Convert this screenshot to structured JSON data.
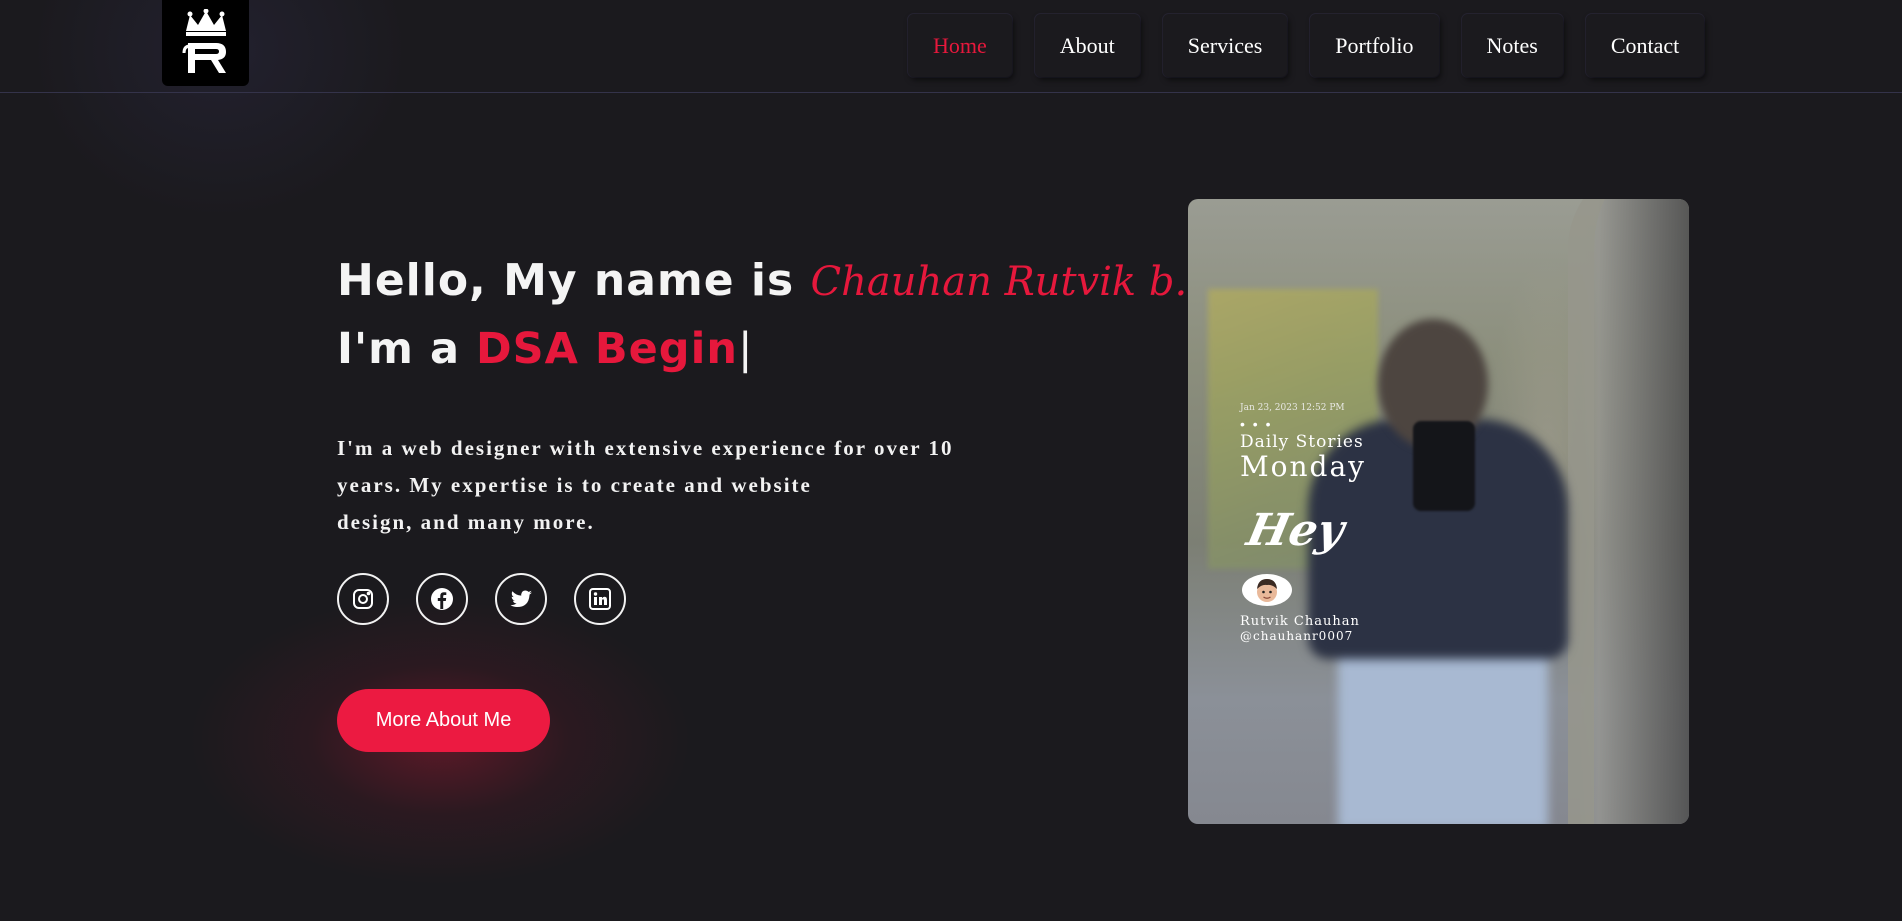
{
  "header": {
    "logo": {
      "icon": "crown-r-monogram-icon",
      "text": "R"
    },
    "nav": [
      {
        "label": "Home",
        "active": true
      },
      {
        "label": "About",
        "active": false
      },
      {
        "label": "Services",
        "active": false
      },
      {
        "label": "Portfolio",
        "active": false
      },
      {
        "label": "Notes",
        "active": false
      },
      {
        "label": "Contact",
        "active": false
      }
    ]
  },
  "hero": {
    "greeting": "Hello, My name is",
    "name": "Chauhan Rutvik b.",
    "role_prefix": "I'm a",
    "role": "DSA Begin",
    "cursor": "|",
    "description": [
      "I'm a web designer with extensive experience for over 10",
      "years. My expertise is to create and website",
      "design, and many more."
    ],
    "socials": [
      {
        "name": "instagram-icon"
      },
      {
        "name": "facebook-icon"
      },
      {
        "name": "twitter-icon"
      },
      {
        "name": "linkedin-icon"
      }
    ],
    "cta_label": "More About Me"
  },
  "photo": {
    "date": "Jan 23, 2023 12:52 PM",
    "dots": "• • •",
    "daily": "Daily Stories",
    "day": "Monday",
    "hey": "Hey",
    "user_name": "Rutvik Chauhan",
    "handle": "@chauhanr0007"
  },
  "colors": {
    "background": "#1b1a1e",
    "accent": "#e6183c",
    "button": "#ec1a41",
    "text": "#f2f2f2"
  }
}
